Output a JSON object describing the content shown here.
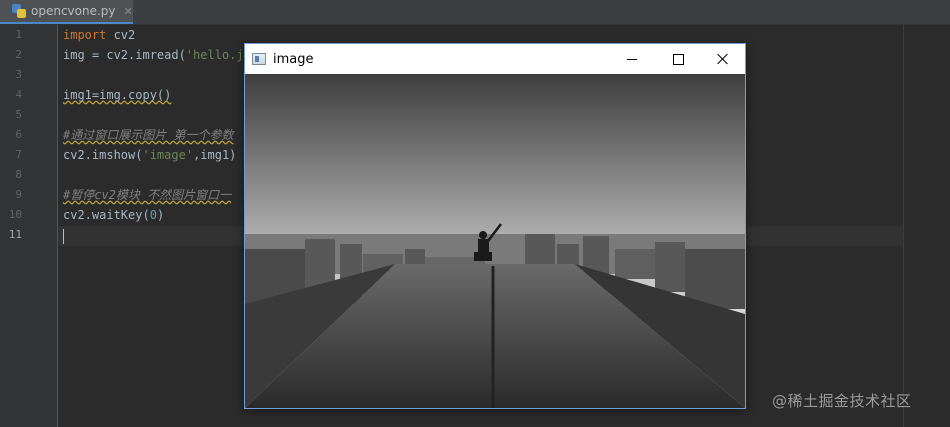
{
  "tab": {
    "filename": "opencvone.py",
    "close": "✕"
  },
  "editor": {
    "line_numbers": [
      "1",
      "2",
      "3",
      "4",
      "5",
      "6",
      "7",
      "8",
      "9",
      "10",
      "11"
    ],
    "active_line": "11",
    "code": {
      "l1_kw": "import",
      "l1_rest": " cv2",
      "l2_a": "img = cv2.imread(",
      "l2_str": "'hello.jp",
      "l4": "img1=img.copy()",
      "l6": "#通过窗口展示图片 第一个参数",
      "l7_a": "cv2.imshow(",
      "l7_str": "'image'",
      "l7_b": ",img1)",
      "l9": "#暂停cv2模块 不然图片窗口一",
      "l10_a": "cv2.waitKey(",
      "l10_num": "0",
      "l10_b": ")"
    }
  },
  "image_window": {
    "title": "image",
    "icons": {
      "app": "window-app-icon",
      "minimize": "minimize-icon",
      "maximize": "maximize-icon",
      "close": "close-icon"
    }
  },
  "watermark": "@稀土掘金技术社区",
  "colors": {
    "editor_bg": "#2b2b2b",
    "keyword": "#cc7832",
    "string": "#6a8759",
    "number": "#6897bb",
    "comment": "#808080",
    "text": "#a9b7c6",
    "window_border": "#6f9fd6"
  }
}
